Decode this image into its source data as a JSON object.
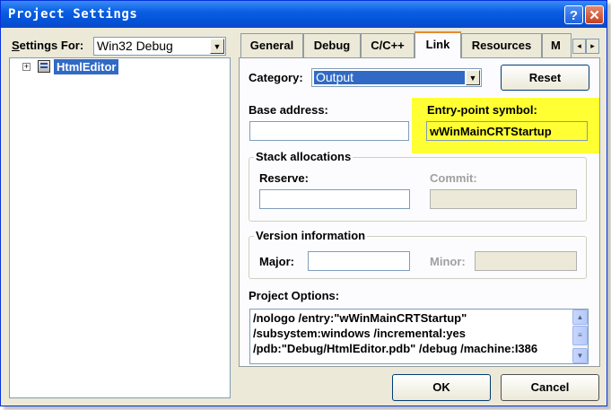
{
  "window": {
    "title": "Project Settings",
    "help_icon": "?",
    "close_icon": "✕"
  },
  "left": {
    "settings_for_label": "Settings For:",
    "settings_for_value": "Win32 Debug",
    "tree": {
      "expander": "+",
      "project_name": "HtmlEditor"
    }
  },
  "tabs": [
    {
      "label": "General"
    },
    {
      "label": "Debug"
    },
    {
      "label": "C/C++"
    },
    {
      "label": "Link"
    },
    {
      "label": "Resources"
    },
    {
      "label": "M"
    }
  ],
  "tab_scroll": {
    "left": "◂",
    "right": "▸"
  },
  "link": {
    "category_label": "Category:",
    "category_value": "Output",
    "reset_label": "Reset",
    "base_address_label": "Base address:",
    "base_address_value": "",
    "entry_point_label": "Entry-point symbol:",
    "entry_point_value": "wWinMainCRTStartup",
    "highlight_color": "#ffff33",
    "stack": {
      "title": "Stack allocations",
      "reserve_label": "Reserve:",
      "reserve_value": "",
      "commit_label": "Commit:",
      "commit_value": ""
    },
    "version": {
      "title": "Version information",
      "major_label": "Major:",
      "major_value": "",
      "minor_label": "Minor:",
      "minor_value": ""
    },
    "project_options_label": "Project Options:",
    "project_options_lines": [
      "/nologo /entry:\"wWinMainCRTStartup\"",
      "/subsystem:windows /incremental:yes",
      "/pdb:\"Debug/HtmlEditor.pdb\" /debug /machine:I386"
    ]
  },
  "buttons": {
    "ok": "OK",
    "cancel": "Cancel"
  },
  "colors": {
    "title_bar": "#0a5fe3",
    "dialog_bg": "#ece9d8",
    "selection": "#316ac5",
    "active_tab_accent": "#e68b2c"
  }
}
